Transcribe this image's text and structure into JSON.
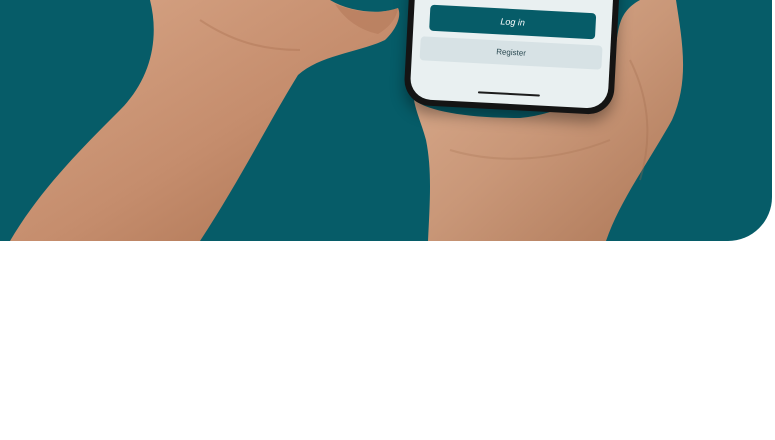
{
  "colors": {
    "hero_background": "#065c68",
    "page_background": "#ffffff",
    "primary_button": "#065c68",
    "secondary_button": "#d7e2e5",
    "skin_tone": "#c99778"
  },
  "phone": {
    "login_label": "Log in",
    "register_label": "Register"
  },
  "icons": {
    "hand": "hand-illustration",
    "phone": "smartphone-icon"
  }
}
